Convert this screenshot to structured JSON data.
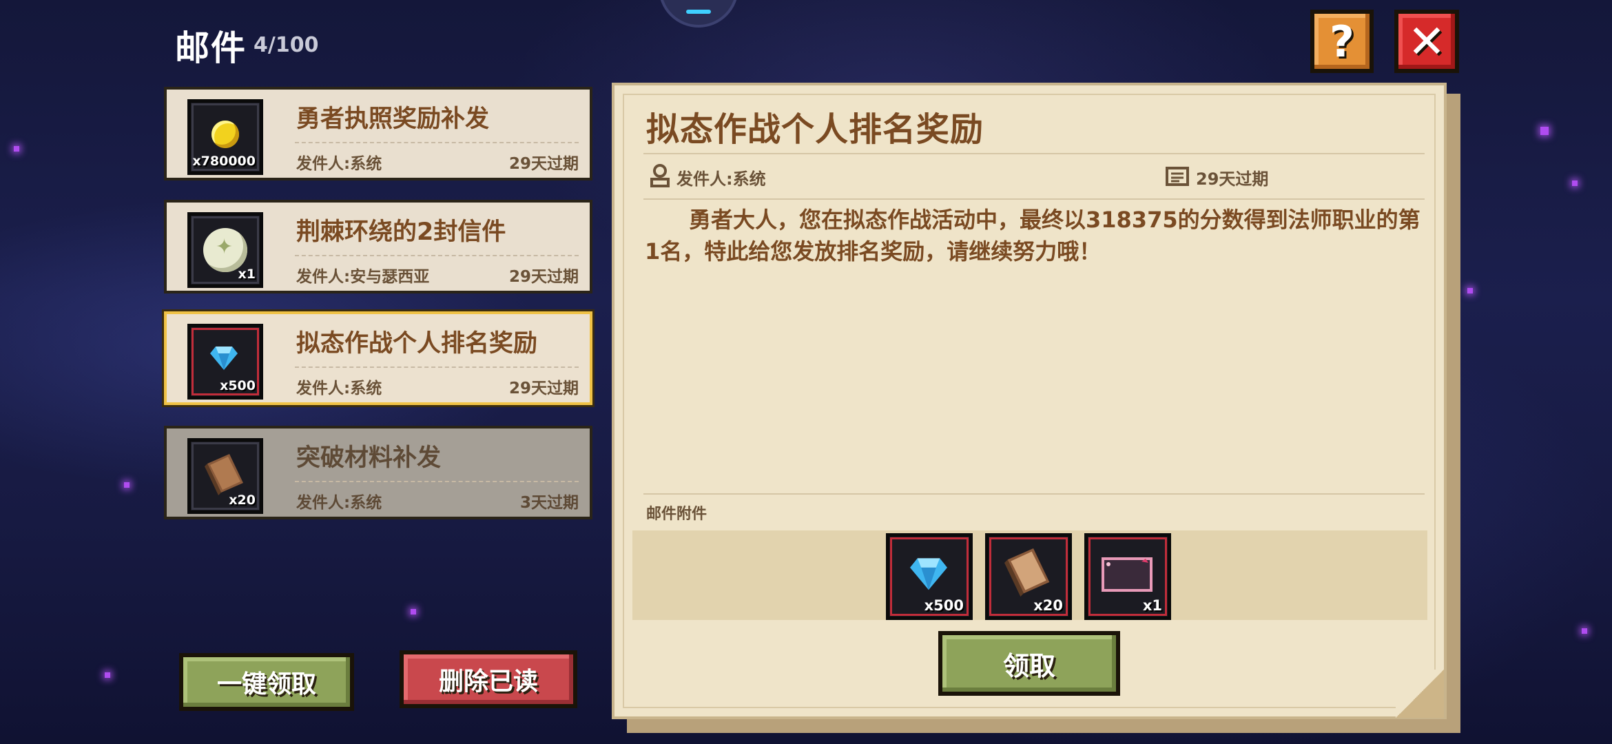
{
  "header": {
    "title": "邮件",
    "count": "4/100"
  },
  "mails": [
    {
      "title": "勇者执照奖励补发",
      "sender": "发件人:系统",
      "expiry": "29天过期",
      "icon": "gold-coin-icon",
      "qty": "x780000"
    },
    {
      "title": "荆棘环绕的2封信件",
      "sender": "发件人:安与瑟西亚",
      "expiry": "29天过期",
      "icon": "sealed-letter-icon",
      "qty": "x1"
    },
    {
      "title": "拟态作战个人排名奖励",
      "sender": "发件人:系统",
      "expiry": "29天过期",
      "icon": "blue-gem-icon",
      "qty": "x500"
    },
    {
      "title": "突破材料补发",
      "sender": "发件人:系统",
      "expiry": "3天过期",
      "icon": "book-icon",
      "qty": "x20"
    }
  ],
  "buttons": {
    "claim_all": "一键领取",
    "delete_read": "删除已读",
    "claim": "领取",
    "help": "?",
    "close": "✕"
  },
  "detail": {
    "title": "拟态作战个人排名奖励",
    "sender": "发件人:系统",
    "expiry": "29天过期",
    "body": "勇者大人，您在拟态作战活动中，最终以318375的分数得到法师职业的第1名，特此给您发放排名奖励，请继续努力哦！",
    "attachments_label": "邮件附件",
    "attachments": [
      {
        "icon": "blue-gem-icon",
        "qty": "x500"
      },
      {
        "icon": "book-icon",
        "qty": "x20"
      },
      {
        "icon": "pink-frame-icon",
        "qty": "x1"
      }
    ]
  },
  "colors": {
    "title_brown": "#7a4a22",
    "paper": "#efe4c9",
    "selected_border": "#f0c246",
    "green_button": "#8ea35a",
    "red_button": "#c9484d"
  }
}
